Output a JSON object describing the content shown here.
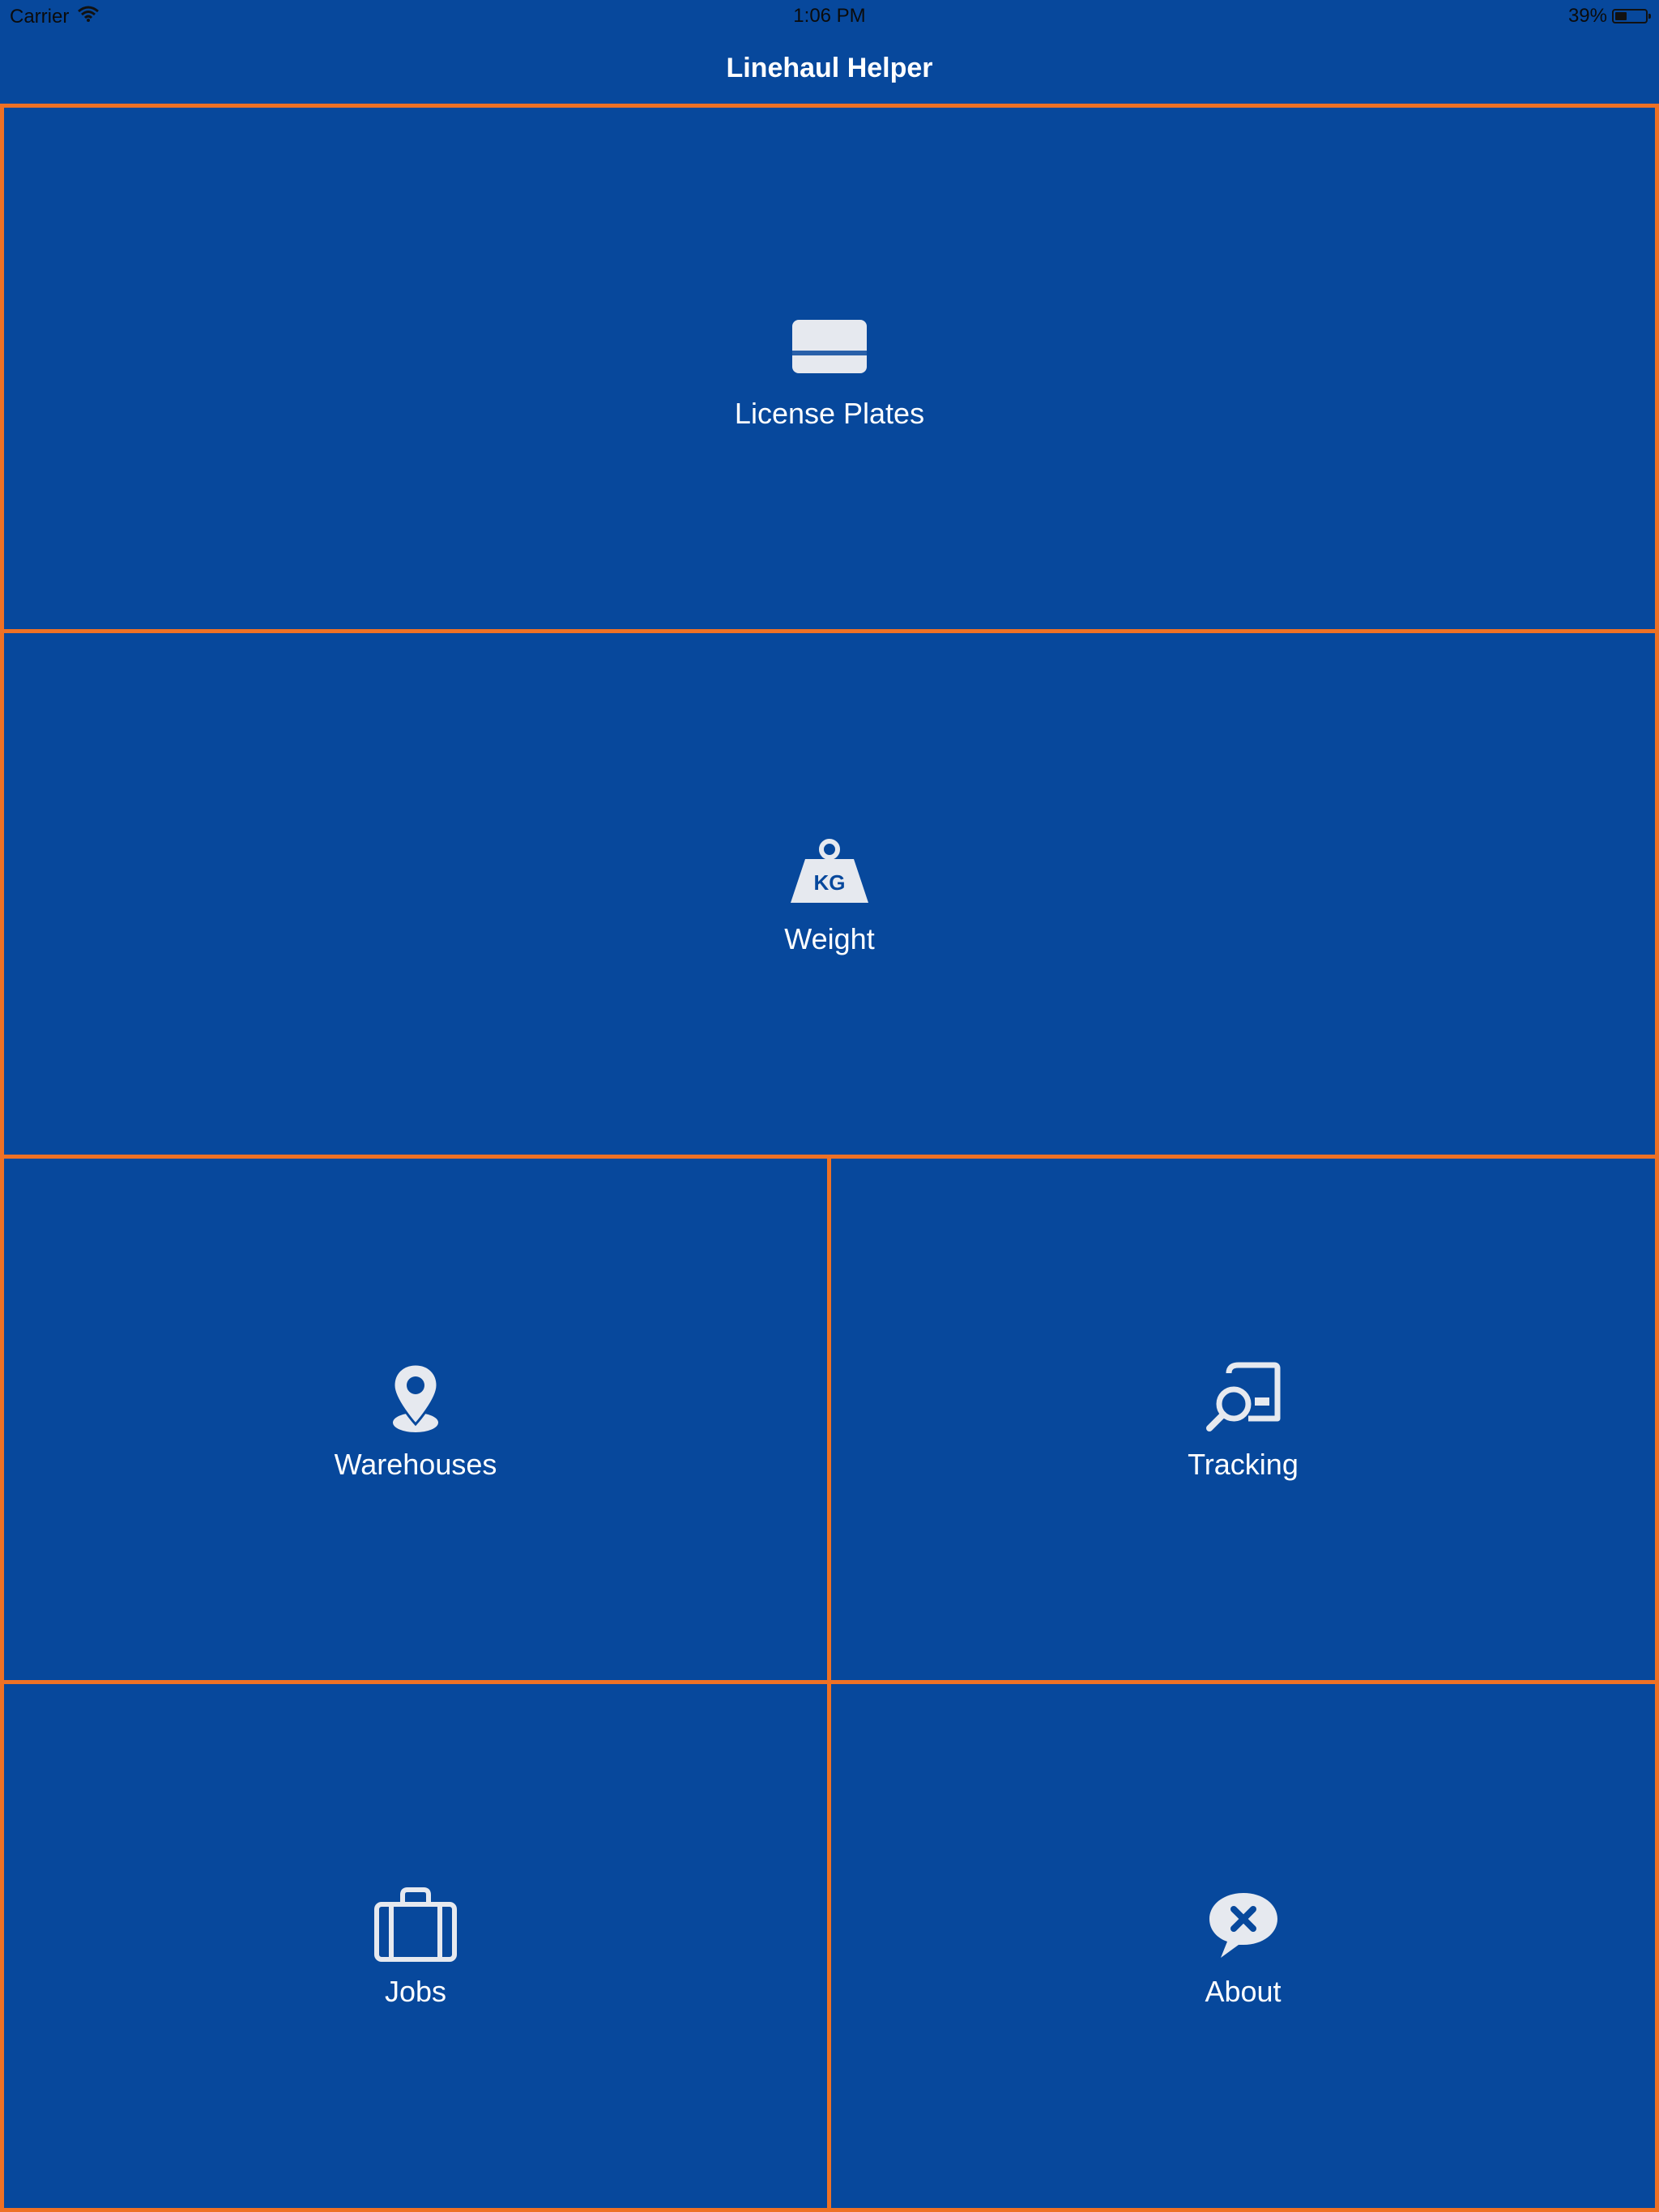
{
  "status_bar": {
    "carrier": "Carrier",
    "time": "1:06 PM",
    "battery": "39%",
    "battery_level": 0.39
  },
  "nav": {
    "title": "Linehaul Helper"
  },
  "tiles": [
    {
      "label": "License Plates",
      "icon": "license-plate-icon"
    },
    {
      "label": "Weight",
      "icon": "weight-kg-icon",
      "icon_text": "KG"
    },
    {
      "label": "Warehouses",
      "icon": "map-pin-icon"
    },
    {
      "label": "Tracking",
      "icon": "tracking-search-icon"
    },
    {
      "label": "Jobs",
      "icon": "briefcase-icon"
    },
    {
      "label": "About",
      "icon": "speech-bubble-x-icon"
    }
  ],
  "colors": {
    "background": "#07489c",
    "tile_border": "#ee7125",
    "icon": "#e6e9ef",
    "text": "#ffffff"
  }
}
